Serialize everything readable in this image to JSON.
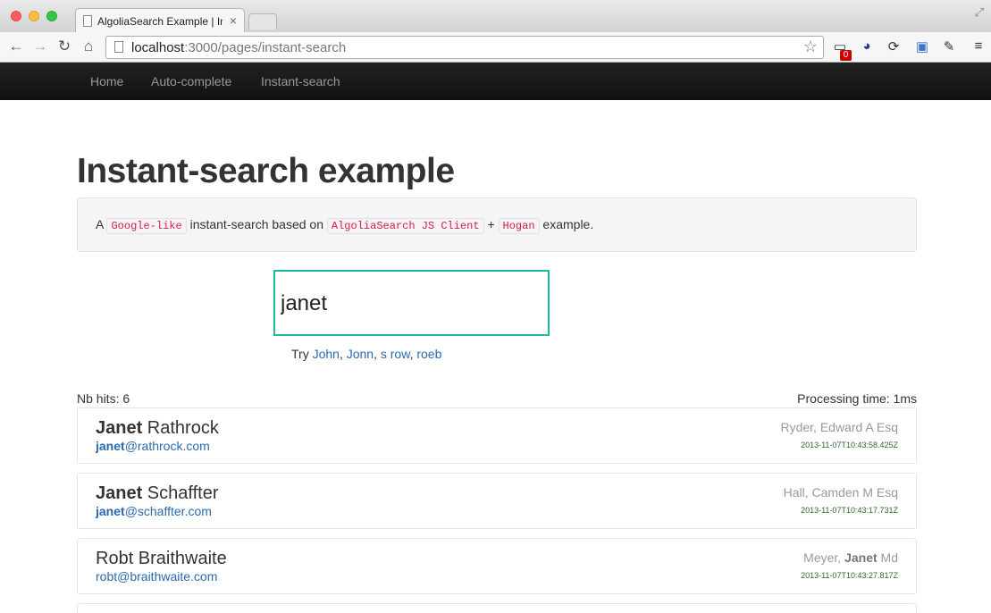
{
  "browser": {
    "tab_title": "AlgoliaSearch Example | Instant-search",
    "tab_close": "×",
    "url_host": "localhost",
    "url_rest": ":3000/pages/instant-search",
    "ext_badge": "0"
  },
  "navbar": {
    "items": [
      {
        "label": "Home"
      },
      {
        "label": "Auto-complete"
      },
      {
        "label": "Instant-search"
      }
    ]
  },
  "main": {
    "title": "Instant-search example",
    "description": {
      "prefix": "A",
      "code1": "Google-like",
      "middle": "instant-search based on",
      "code2": "AlgoliaSearch JS Client",
      "plus": "+",
      "code3": "Hogan",
      "suffix": "example."
    },
    "search": {
      "value": "janet",
      "placeholder": ""
    },
    "try": {
      "label": "Try",
      "suggestions": [
        "John",
        "Jonn",
        "s row",
        "roeb"
      ]
    },
    "nb_hits": "Nb hits: 6",
    "processing_time": "Processing time: 1ms",
    "hits": [
      {
        "name_hl": "Janet",
        "name_rest": " Rathrock",
        "email_hl": "janet",
        "email_rest": "@rathrock.com",
        "company_pre": "Ryder, Edward A Esq",
        "company_hl": "",
        "company_post": "",
        "date": "2013-11-07T10:43:58.425Z"
      },
      {
        "name_hl": "Janet",
        "name_rest": " Schaffter",
        "email_hl": "janet",
        "email_rest": "@schaffter.com",
        "company_pre": "Hall, Camden M Esq",
        "company_hl": "",
        "company_post": "",
        "date": "2013-11-07T10:43:17.731Z"
      },
      {
        "name_hl": "",
        "name_rest": "Robt Braithwaite",
        "email_hl": "",
        "email_rest": "robt@braithwaite.com",
        "company_pre": "Meyer, ",
        "company_hl": "Janet",
        "company_post": " Md",
        "date": "2013-11-07T10:43:27.817Z"
      }
    ]
  }
}
